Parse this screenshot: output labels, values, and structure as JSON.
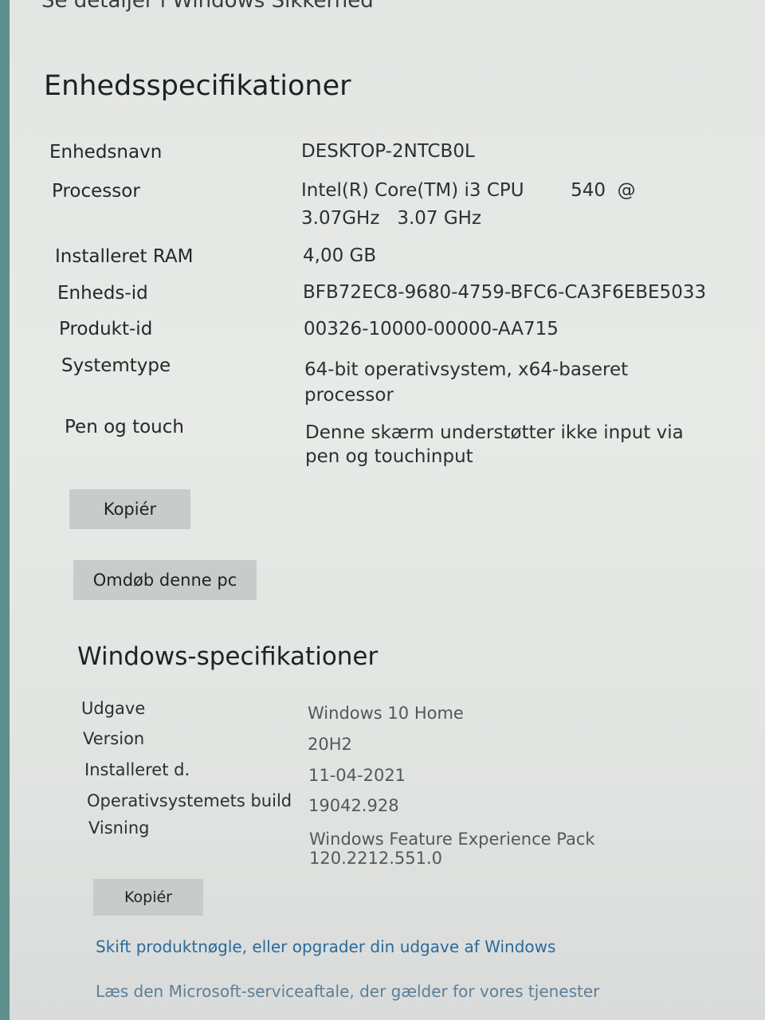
{
  "top_cut_text": "Se detaljer i Windows Sikkerhed",
  "device_specs": {
    "title": "Enhedsspecifikationer",
    "rows": [
      {
        "label": "Enhedsnavn",
        "value_lines": [
          "DESKTOP-2NTCB0L"
        ]
      },
      {
        "label": "Processor",
        "value_lines": [
          "Intel(R) Core(TM) i3 CPU        540  @",
          "3.07GHz   3.07 GHz"
        ]
      },
      {
        "label": "Installeret RAM",
        "value_lines": [
          "4,00 GB"
        ]
      },
      {
        "label": "Enheds-id",
        "value_lines": [
          "BFB72EC8-9680-4759-BFC6-CA3F6EBE5033"
        ]
      },
      {
        "label": "Produkt-id",
        "value_lines": [
          "00326-10000-00000-AA715"
        ]
      },
      {
        "label": "Systemtype",
        "value_lines": [
          "64-bit operativsystem, x64-baseret",
          "processor"
        ]
      },
      {
        "label": "Pen og touch",
        "value_lines": [
          "Denne skærm understøtter ikke input via",
          "pen og touchinput"
        ]
      }
    ],
    "copy_button": "Kopiér",
    "rename_button": "Omdøb denne pc"
  },
  "windows_specs": {
    "title": "Windows-specifikationer",
    "rows": [
      {
        "label": "Udgave",
        "value_lines": [
          "Windows 10 Home"
        ]
      },
      {
        "label": "Version",
        "value_lines": [
          "20H2"
        ]
      },
      {
        "label": "Installeret d.",
        "value_lines": [
          "11-04-2021"
        ]
      },
      {
        "label": "Operativsystemets build",
        "value_lines": [
          "19042.928"
        ]
      },
      {
        "label": "Visning",
        "value_lines": [
          "Windows Feature Experience Pack",
          "120.2212.551.0"
        ]
      }
    ],
    "copy_button": "Kopiér"
  },
  "links": {
    "change_key": "Skift produktnøgle, eller opgrader din udgave af Windows",
    "service_agreement": "Læs den Microsoft-serviceaftale, der gælder for vores tjenester"
  }
}
